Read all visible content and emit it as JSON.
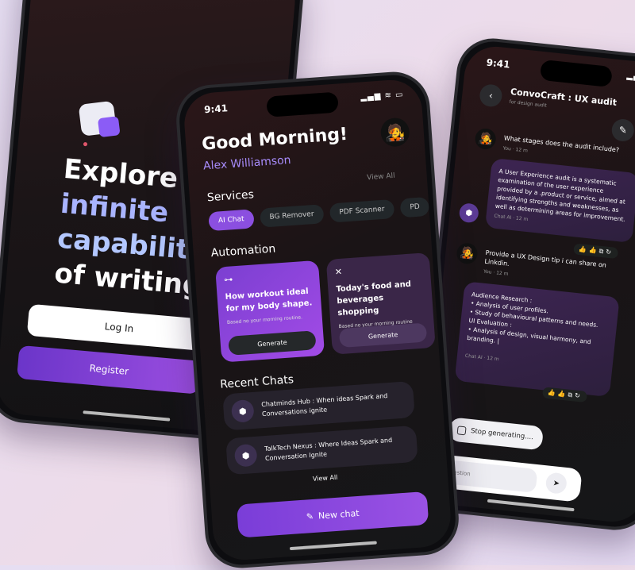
{
  "status": {
    "time": "9:41",
    "signal": "▂▄▆ ≋ ▭"
  },
  "onboarding": {
    "hero": [
      "Explore",
      "infinite",
      "capabilities",
      "of writing"
    ],
    "login_label": "Log In",
    "register_label": "Register"
  },
  "home": {
    "greeting": "Good Morning!",
    "user_name": "Alex Williamson",
    "view_all_top": "View All",
    "services_title": "Services",
    "services": [
      "AI Chat",
      "BG Remover",
      "PDF Scanner",
      "PD"
    ],
    "automation_title": "Automation",
    "automation": [
      {
        "icon": "dumbbell-icon",
        "title": "How workout ideal for my body shape.",
        "subtitle": "Based no your morning routine.",
        "button": "Generate"
      },
      {
        "icon": "utensils-icon",
        "title": "Today's food and beverages shopping",
        "subtitle": "Based no your morning routine",
        "button": "Generate"
      }
    ],
    "recent_title": "Recent Chats",
    "recent": [
      "Chatminds Hub : When ideas Spark and Conversations ignite",
      "TalkTech Nexus : Where Ideas Spark and Conversation Ignite"
    ],
    "view_all_bottom": "View All",
    "new_chat_label": "New chat"
  },
  "chat": {
    "title": "ConvoCraft : UX audit",
    "subtitle": "for design audit",
    "messages": [
      {
        "text": "What stages does the audit include?",
        "meta": "You · 12 m"
      },
      {
        "text": "A User Experience audit is a systematic examination of the user experience provided by a .product or service, aimed at identifying strengths and weaknesses, as well as determining areas for improvement.",
        "meta": "Chat  AI · 12 m"
      },
      {
        "text": "Provide a UX Design tip i can share on Linkdin.",
        "meta": "You · 12 m"
      },
      {
        "lines": [
          "Audience Research :",
          "•  Analysis of user profiles.",
          "•  Study of behavioural patterns and needs.",
          "UI Evaluation :",
          "•  Analysis of design, visual harmony, and branding. |"
        ],
        "meta": "Chat  AI · 12 m"
      }
    ],
    "actions": "👍👍⧉↻",
    "stop_label": "Stop generating....",
    "input_placeholder": "your question"
  },
  "colors": {
    "accent": "#8b4fe0",
    "background": "#e9def0"
  }
}
